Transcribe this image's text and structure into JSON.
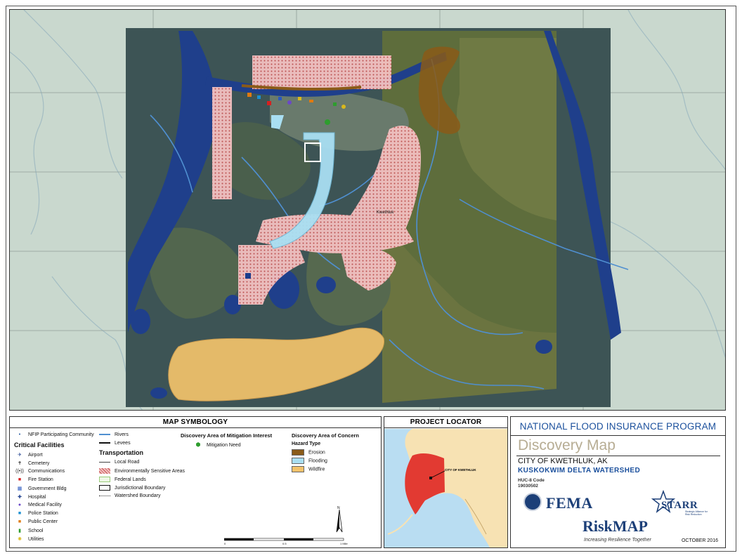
{
  "colors": {
    "river": "#1f3f8b",
    "river_line": "#4f8fd0",
    "outer_background": "#cad8ce",
    "imagery_dark": "#344a4a",
    "erosion": "#8a5b18",
    "flooding": "#a9dff2",
    "wildfire": "#f3c36b",
    "sensitive": "#f3b7b7",
    "fema_blue": "#1c3f78",
    "title_blue": "#1a4f9c",
    "discovery_gray": "#b7ad94",
    "mitigation_green": "#2e9d2e",
    "locator_water": "#b9ddf2",
    "locator_land": "#f7e2b3",
    "locator_ak": "#e23a32"
  },
  "symbology": {
    "title": "MAP SYMBOLOGY",
    "nfip_label": "NFIP Participating Community",
    "critical_title": "Critical Facilities",
    "critical_items": [
      {
        "label": "Airport",
        "icon": "airport-icon",
        "glyph": "✈",
        "color": "#1a3c8c"
      },
      {
        "label": "Cemetery",
        "icon": "cemetery-icon",
        "glyph": "✝",
        "color": "#222222"
      },
      {
        "label": "Communications",
        "icon": "communications-icon",
        "glyph": "((•))",
        "color": "#222222"
      },
      {
        "label": "Fire Station",
        "icon": "fire-station-icon",
        "glyph": "■",
        "color": "#d62020"
      },
      {
        "label": "Government Bldg",
        "icon": "government-building-icon",
        "glyph": "▦",
        "color": "#2a58c0"
      },
      {
        "label": "Hospital",
        "icon": "hospital-icon",
        "glyph": "✚",
        "color": "#1a3c8c"
      },
      {
        "label": "Medical Facility",
        "icon": "medical-facility-icon",
        "glyph": "●",
        "color": "#6a48c8"
      },
      {
        "label": "Police Station",
        "icon": "police-station-icon",
        "glyph": "■",
        "color": "#1b8fd1"
      },
      {
        "label": "Public Center",
        "icon": "public-center-icon",
        "glyph": "■",
        "color": "#e07a10"
      },
      {
        "label": "School",
        "icon": "school-icon",
        "glyph": "▮",
        "color": "#2e9d2e"
      },
      {
        "label": "Utilities",
        "icon": "utilities-icon",
        "glyph": "✺",
        "color": "#d9b81c"
      }
    ],
    "rivers_label": "Rivers",
    "levees_label": "Levees",
    "transportation_title": "Transportation",
    "transportation_items": [
      {
        "label": "Local Road",
        "icon": "local-road-icon"
      },
      {
        "label": "Environmentally Sensitive Areas",
        "icon": "sensitive-area-icon"
      },
      {
        "label": "Federal Lands",
        "icon": "federal-lands-icon"
      },
      {
        "label": "Jurisdictional Boundary",
        "icon": "jurisdictional-boundary-icon"
      },
      {
        "label": "Watershed Boundary",
        "icon": "watershed-boundary-icon"
      }
    ],
    "mitigation_title": "Discovery Area of Mitigation Interest",
    "mitigation_need_label": "Mitigation Need",
    "concern_title": "Discovery Area of Concern",
    "hazard_type_title": "Hazard Type",
    "hazards": [
      {
        "label": "Erosion",
        "color": "#8a5b18"
      },
      {
        "label": "Flooding",
        "color": "#a9dff2"
      },
      {
        "label": "Wildfire",
        "color": "#f3c36b"
      }
    ],
    "north_label": "N",
    "scale_labels": [
      "0",
      "0.5",
      "1 Mile"
    ]
  },
  "locator": {
    "title": "PROJECT LOCATOR",
    "label": "CITY OF KWETHLUK"
  },
  "title_block": {
    "program": "NATIONAL FLOOD INSURANCE PROGRAM",
    "map_title": "Discovery Map",
    "city": "CITY OF KWETHLUK, AK",
    "watershed": "KUSKOKWIM DELTA WATERSHED",
    "huc_label": "HUC-8 Code",
    "huc_value": "19030502",
    "fema_logo": "FEMA",
    "starr_logo": "STARR",
    "starr_sub": "Strategic Alliance for Risk Reduction",
    "riskmap_logo": "RiskMAP",
    "riskmap_tagline": "Increasing Resilience Together",
    "date": "OCTOBER 2016"
  },
  "map": {
    "place_label": "Kwethluk"
  }
}
